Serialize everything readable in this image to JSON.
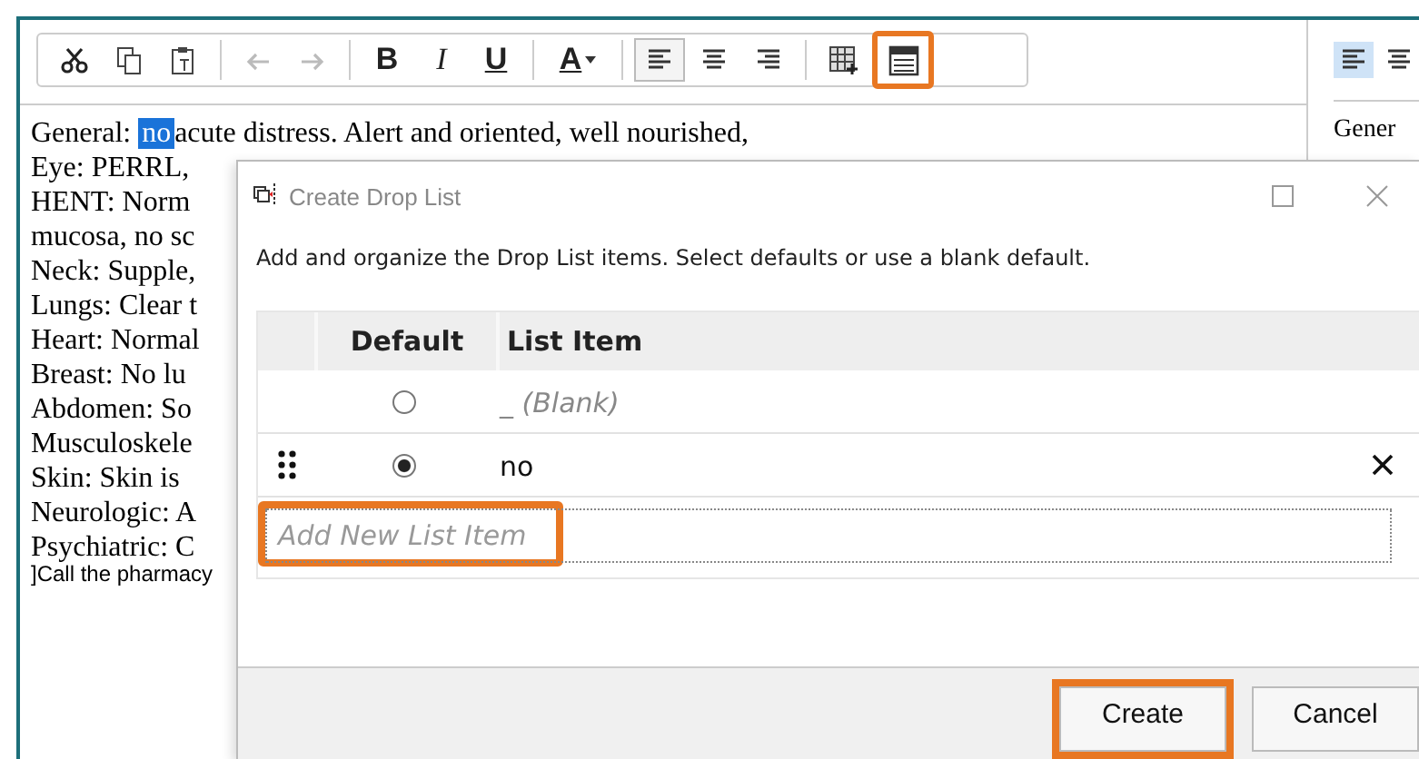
{
  "toolbar": {
    "bold": "B",
    "italic": "I",
    "underline": "U",
    "font_color": "A",
    "undo_disabled": true,
    "redo_disabled": true,
    "align_left_selected": true,
    "drop_list_highlighted": true
  },
  "editor": {
    "first_line": {
      "before": "General: ",
      "selected": "no",
      "after": "acute distress. Alert and oriented, well nourished,"
    },
    "lines": [
      "Eye: PERRL,",
      "HENT: Norm",
      "mucosa, no sc",
      "Neck: Supple,",
      "Lungs: Clear t",
      "Heart: Normal",
      "Breast: No lu",
      "Abdomen: So",
      "Musculoskele",
      "Skin: Skin is",
      "Neurologic: A",
      "Psychiatric: C"
    ],
    "note": "]Call the pharmacy"
  },
  "side_panel": {
    "align_left_selected": true,
    "heading": "Gener"
  },
  "dialog": {
    "title": "Create Drop List",
    "description": "Add and organize the Drop List items. Select defaults or use a blank default.",
    "columns": [
      "Default",
      "List Item"
    ],
    "rows": [
      {
        "kind": "blank",
        "label": "_ (Blank)",
        "selected": false
      },
      {
        "kind": "item",
        "label": "no",
        "selected": true
      }
    ],
    "new_item": {
      "placeholder": "Add New List Item",
      "highlighted": true
    },
    "buttons": [
      {
        "label": "Create",
        "highlighted": true
      },
      {
        "label": "Cancel",
        "highlighted": false
      }
    ]
  }
}
